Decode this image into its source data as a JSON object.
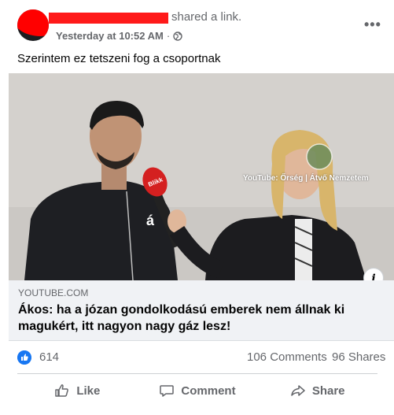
{
  "post": {
    "shared_text": "shared a link.",
    "timestamp": "Yesterday at 10:52 AM",
    "privacy_icon": "globe-icon",
    "more_label": "•••",
    "body_text": "Szerintem ez tetszeni fog a csoportnak"
  },
  "media": {
    "watermark": "YouTube: Őrség | Átvő Nemzetem",
    "mic_label": "Blikk",
    "shirt_letter": "á",
    "info_label": "i"
  },
  "link": {
    "domain": "YOUTUBE.COM",
    "title": "Ákos: ha a józan gondolkodású emberek nem állnak ki magukért, itt nagyon nagy gáz lesz!"
  },
  "stats": {
    "likes": "614",
    "comments": "106 Comments",
    "shares": "96 Shares"
  },
  "actions": {
    "like": "Like",
    "comment": "Comment",
    "share": "Share"
  },
  "colors": {
    "accent": "#1877f2",
    "redaction": "#ff0000",
    "secondary_text": "#65676b"
  }
}
